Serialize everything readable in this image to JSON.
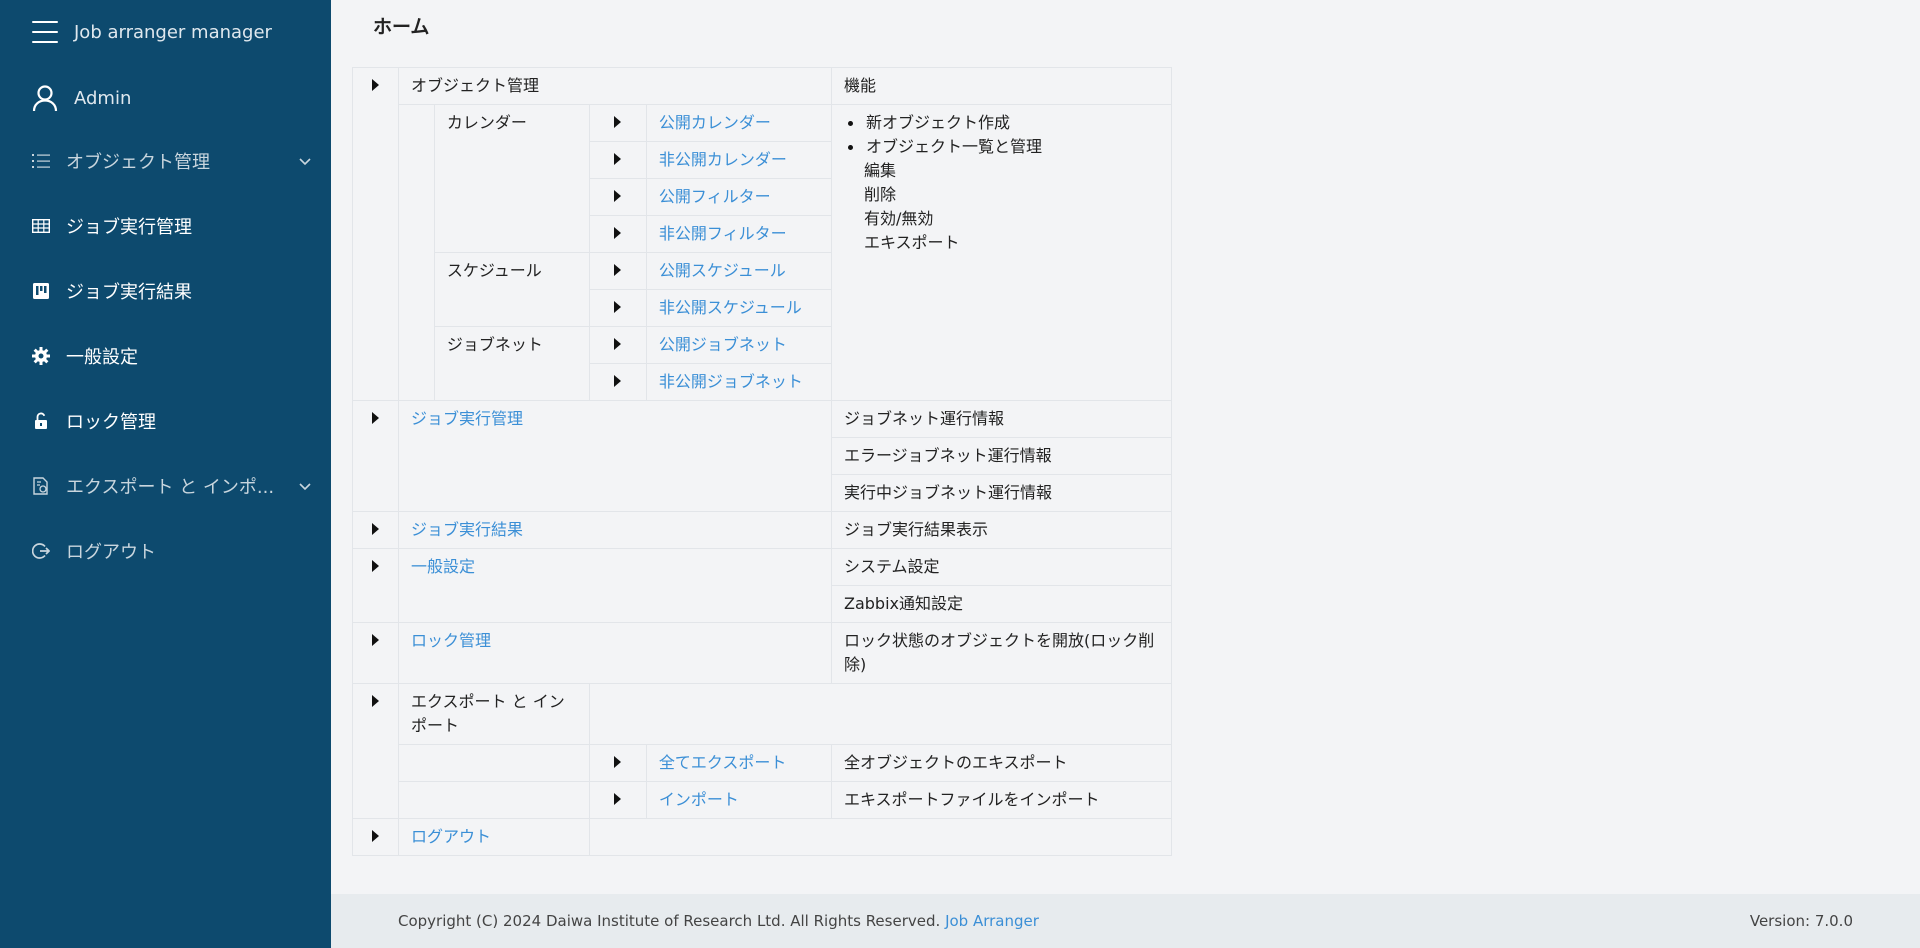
{
  "sidebar": {
    "app_title": "Job arranger manager",
    "user": "Admin",
    "items": [
      {
        "label": "オブジェクト管理",
        "icon": "list-icon",
        "has_chevron": true
      },
      {
        "label": "ジョブ実行管理",
        "icon": "table-icon",
        "has_chevron": false
      },
      {
        "label": "ジョブ実行結果",
        "icon": "board-icon",
        "has_chevron": false
      },
      {
        "label": "一般設定",
        "icon": "gear-icon",
        "has_chevron": false
      },
      {
        "label": "ロック管理",
        "icon": "lock-icon",
        "has_chevron": false
      },
      {
        "label": "エクスポート と インポ...",
        "icon": "file-export-icon",
        "has_chevron": true
      },
      {
        "label": "ログアウト",
        "icon": "logout-icon",
        "has_chevron": false
      }
    ]
  },
  "main": {
    "page_title": "ホーム",
    "tree": {
      "object_mgmt": {
        "label": "オブジェクト管理",
        "feature_header": "機能",
        "features_bulleted": [
          "新オブジェクト作成",
          "オブジェクト一覧と管理"
        ],
        "features_plain": [
          "編集",
          "削除",
          "有効/無効",
          "エキスポート"
        ],
        "groups": [
          {
            "label": "カレンダー",
            "links": [
              "公開カレンダー",
              "非公開カレンダー",
              "公開フィルター",
              "非公開フィルター"
            ]
          },
          {
            "label": "スケジュール",
            "links": [
              "公開スケジュール",
              "非公開スケジュール"
            ]
          },
          {
            "label": "ジョブネット",
            "links": [
              "公開ジョブネット",
              "非公開ジョブネット"
            ]
          }
        ]
      },
      "job_exec_mgmt": {
        "label": "ジョブ実行管理",
        "descs": [
          "ジョブネット運行情報",
          "エラージョブネット運行情報",
          "実行中ジョブネット運行情報"
        ]
      },
      "job_exec_result": {
        "label": "ジョブ実行結果",
        "descs": [
          "ジョブ実行結果表示"
        ]
      },
      "general": {
        "label": "一般設定",
        "descs": [
          "システム設定",
          "Zabbix通知設定"
        ]
      },
      "lock": {
        "label": "ロック管理",
        "descs": [
          "ロック状態のオブジェクトを開放(ロック削除)"
        ]
      },
      "export_import": {
        "label": "エクスポート と インポート",
        "rows": [
          {
            "link": "全てエクスポート",
            "desc": "全オブジェクトのエキスポート"
          },
          {
            "link": "インポート",
            "desc": "エキスポートファイルをインポート"
          }
        ]
      },
      "logout": {
        "label": "ログアウト"
      }
    }
  },
  "footer": {
    "copyright": "Copyright (C) 2024 Daiwa Institute of Research Ltd. All Rights Reserved.",
    "link": "Job Arranger",
    "version": "Version: 7.0.0"
  },
  "colors": {
    "sidebar_bg": "#0d4a6e",
    "link": "#3b8fd6",
    "page_bg": "#f3f4f6"
  }
}
